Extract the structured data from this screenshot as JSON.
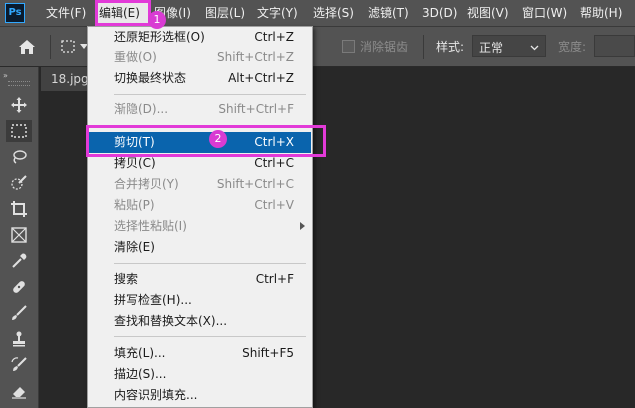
{
  "menubar": {
    "logo": "Ps",
    "items": [
      {
        "label": "文件(F)"
      },
      {
        "label": "编辑(E)"
      },
      {
        "label": "图像(I)"
      },
      {
        "label": "图层(L)"
      },
      {
        "label": "文字(Y)"
      },
      {
        "label": "选择(S)"
      },
      {
        "label": "滤镜(T)"
      },
      {
        "label": "3D(D)"
      },
      {
        "label": "视图(V)"
      },
      {
        "label": "窗口(W)"
      },
      {
        "label": "帮助(H)"
      }
    ]
  },
  "options": {
    "antialias_label": "消除锯齿",
    "style_label": "样式:",
    "style_value": "正常",
    "width_label": "宽度:"
  },
  "document": {
    "tab_title": "18.jpg @"
  },
  "tools": [
    {
      "icon": "move-tool-icon"
    },
    {
      "icon": "marquee-tool-icon"
    },
    {
      "icon": "lasso-tool-icon"
    },
    {
      "icon": "quick-select-tool-icon"
    },
    {
      "icon": "crop-tool-icon"
    },
    {
      "icon": "frame-tool-icon"
    },
    {
      "icon": "eyedropper-tool-icon"
    },
    {
      "icon": "healing-brush-tool-icon"
    },
    {
      "icon": "brush-tool-icon"
    },
    {
      "icon": "clone-stamp-tool-icon"
    },
    {
      "icon": "history-brush-tool-icon"
    },
    {
      "icon": "eraser-tool-icon"
    }
  ],
  "edit_menu": {
    "items": [
      {
        "label": "还原矩形选框(O)",
        "shortcut": "Ctrl+Z"
      },
      {
        "label": "重做(O)",
        "shortcut": "Shift+Ctrl+Z"
      },
      {
        "label": "切换最终状态",
        "shortcut": "Alt+Ctrl+Z"
      },
      {
        "label": "渐隐(D)...",
        "shortcut": "Shift+Ctrl+F"
      },
      {
        "label": "剪切(T)",
        "shortcut": "Ctrl+X"
      },
      {
        "label": "拷贝(C)",
        "shortcut": "Ctrl+C"
      },
      {
        "label": "合并拷贝(Y)",
        "shortcut": "Shift+Ctrl+C"
      },
      {
        "label": "粘贴(P)",
        "shortcut": "Ctrl+V"
      },
      {
        "label": "选择性粘贴(I)",
        "shortcut": ""
      },
      {
        "label": "清除(E)",
        "shortcut": ""
      },
      {
        "label": "搜索",
        "shortcut": "Ctrl+F"
      },
      {
        "label": "拼写检查(H)...",
        "shortcut": ""
      },
      {
        "label": "查找和替换文本(X)...",
        "shortcut": ""
      },
      {
        "label": "填充(L)...",
        "shortcut": "Shift+F5"
      },
      {
        "label": "描边(S)...",
        "shortcut": ""
      },
      {
        "label": "内容识别填充...",
        "shortcut": ""
      }
    ]
  },
  "annotations": {
    "badge1": "1",
    "badge2": "2"
  },
  "colors": {
    "highlight": "#0a64ad",
    "annotation": "#e23ad8",
    "panel": "#535353"
  }
}
